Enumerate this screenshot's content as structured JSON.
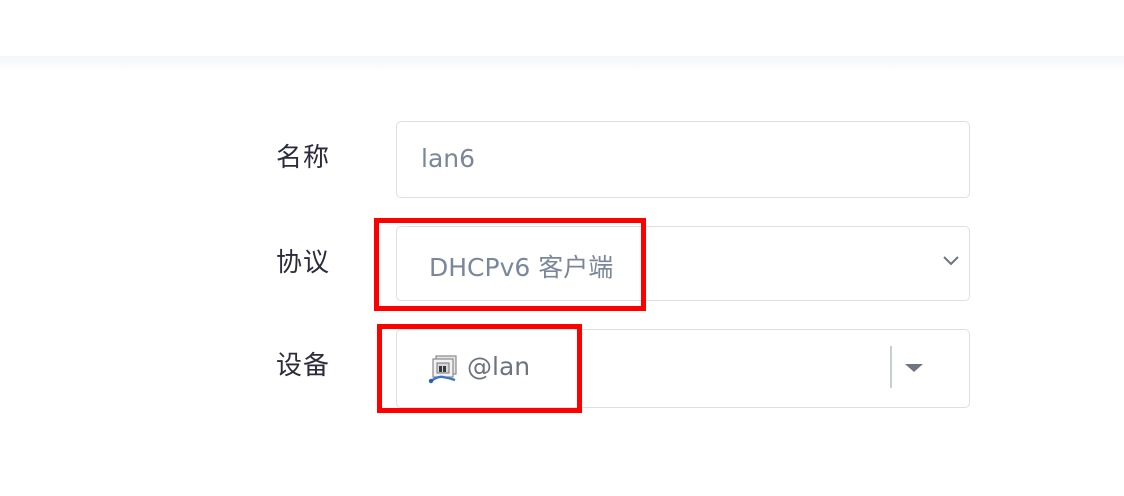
{
  "form": {
    "name_label": "名称",
    "name_value": "lan6",
    "protocol_label": "协议",
    "protocol_value": "DHCPv6 客户端",
    "device_label": "设备",
    "device_value": "@lan"
  },
  "icons": {
    "protocol_dropdown": "chevron-down-icon",
    "device_dropdown": "caret-down-icon",
    "device": "network-interface-icon"
  },
  "colors": {
    "highlight": "#ff0000",
    "label_text": "#2b2b3c",
    "value_text": "#7a879a",
    "field_border": "#dcdfe4"
  }
}
